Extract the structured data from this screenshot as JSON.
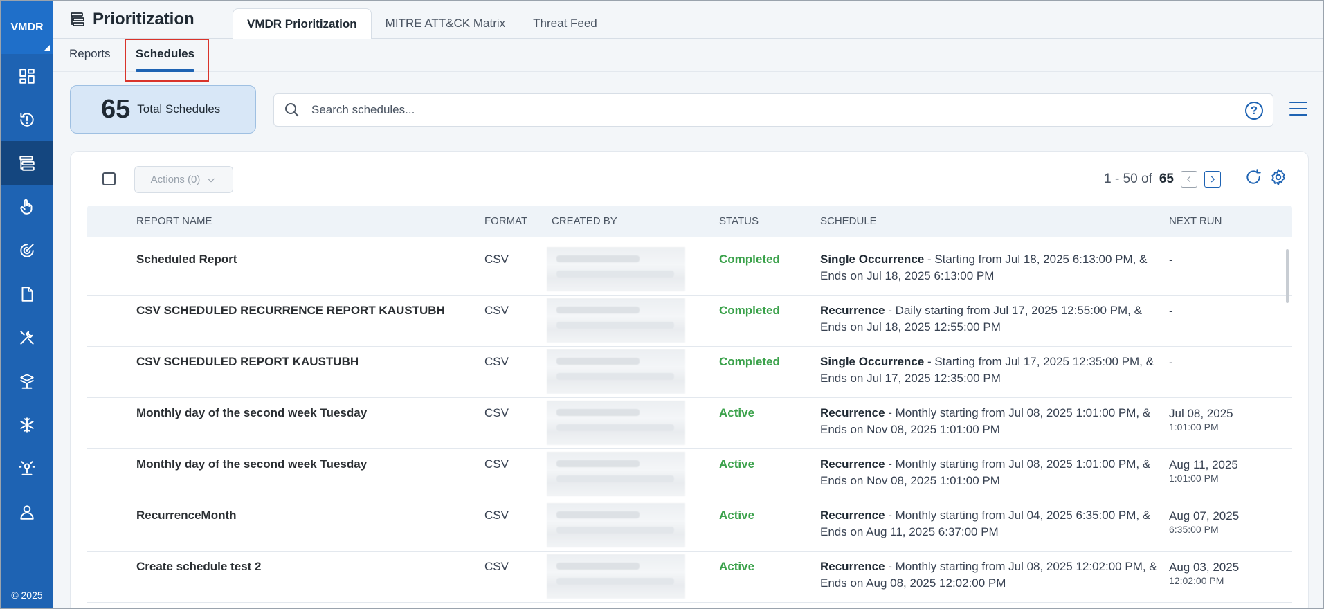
{
  "sidebar": {
    "brand": "VMDR",
    "copyright": "© 2025",
    "items": [
      {
        "icon": "dashboard-icon"
      },
      {
        "icon": "alert-timer-icon"
      },
      {
        "icon": "prioritization-icon",
        "active": true
      },
      {
        "icon": "hand-pointer-icon"
      },
      {
        "icon": "radar-icon"
      },
      {
        "icon": "document-icon"
      },
      {
        "icon": "tools-icon"
      },
      {
        "icon": "network-icon"
      },
      {
        "icon": "snowflake-icon"
      },
      {
        "icon": "sensor-icon"
      },
      {
        "icon": "user-icon"
      }
    ]
  },
  "header": {
    "title": "Prioritization",
    "tabs": [
      {
        "label": "VMDR Prioritization",
        "active": true
      },
      {
        "label": "MITRE ATT&CK Matrix"
      },
      {
        "label": "Threat Feed"
      }
    ]
  },
  "subnav": {
    "reports": "Reports",
    "schedules": "Schedules"
  },
  "summary": {
    "count": "65",
    "label": "Total Schedules"
  },
  "search": {
    "placeholder": "Search schedules...",
    "help": "?"
  },
  "toolbar": {
    "actions_label": "Actions (0)",
    "range": "1 - 50 of",
    "total": "65"
  },
  "table": {
    "columns": [
      "Report Name",
      "Format",
      "Created By",
      "Status",
      "Schedule",
      "Next Run"
    ],
    "rows": [
      {
        "name": "Scheduled Report",
        "format": "CSV",
        "status": "Completed",
        "sched_type": "Single Occurrence",
        "sched_text": " - Starting from Jul 18, 2025 6:13:00 PM, & Ends on Jul 18, 2025 6:13:00 PM",
        "next_date": "-",
        "next_time": ""
      },
      {
        "name": "CSV SCHEDULED RECURRENCE REPORT KAUSTUBH",
        "format": "CSV",
        "status": "Completed",
        "sched_type": "Recurrence",
        "sched_text": " - Daily starting from Jul 17, 2025 12:55:00 PM, & Ends on Jul 18, 2025 12:55:00 PM",
        "next_date": "-",
        "next_time": ""
      },
      {
        "name": "CSV SCHEDULED REPORT KAUSTUBH",
        "format": "CSV",
        "status": "Completed",
        "sched_type": "Single Occurrence",
        "sched_text": " - Starting from Jul 17, 2025 12:35:00 PM, & Ends on Jul 17, 2025 12:35:00 PM",
        "next_date": "-",
        "next_time": ""
      },
      {
        "name": "Monthly day of the second week Tuesday",
        "format": "CSV",
        "status": "Active",
        "sched_type": "Recurrence",
        "sched_text": " - Monthly starting from Jul 08, 2025 1:01:00 PM, & Ends on Nov 08, 2025 1:01:00 PM",
        "next_date": "Jul 08, 2025",
        "next_time": "1:01:00 PM"
      },
      {
        "name": "Monthly day of the second week Tuesday",
        "format": "CSV",
        "status": "Active",
        "sched_type": "Recurrence",
        "sched_text": " - Monthly starting from Jul 08, 2025 1:01:00 PM, & Ends on Nov 08, 2025 1:01:00 PM",
        "next_date": "Aug 11, 2025",
        "next_time": "1:01:00 PM"
      },
      {
        "name": "RecurrenceMonth",
        "format": "CSV",
        "status": "Active",
        "sched_type": "Recurrence",
        "sched_text": " - Monthly starting from Jul 04, 2025 6:35:00 PM, & Ends on Aug 11, 2025 6:37:00 PM",
        "next_date": "Aug 07, 2025",
        "next_time": "6:35:00 PM"
      },
      {
        "name": "Create schedule test 2",
        "format": "CSV",
        "status": "Active",
        "sched_type": "Recurrence",
        "sched_text": " - Monthly starting from Jul 08, 2025 12:02:00 PM, & Ends on Aug 08, 2025 12:02:00 PM",
        "next_date": "Aug 03, 2025",
        "next_time": "12:02:00 PM"
      }
    ]
  },
  "colors": {
    "sidebar": "#1e63b3",
    "accent": "#1e63b3",
    "status_green": "#3aa14a",
    "highlight_red": "#d9342b"
  }
}
